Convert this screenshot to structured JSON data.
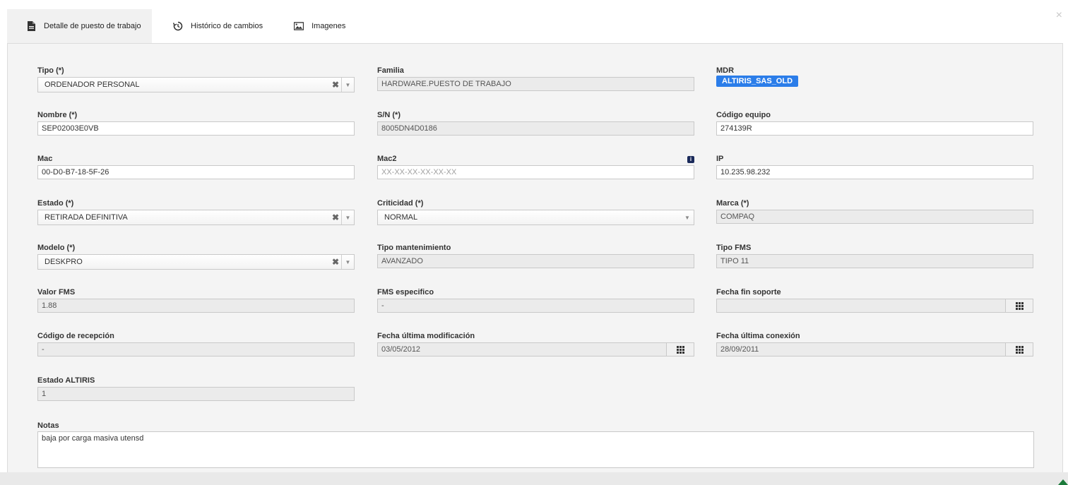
{
  "tabs": [
    {
      "label": "Detalle de puesto de trabajo",
      "icon": "document-icon",
      "active": true
    },
    {
      "label": "Histórico de cambios",
      "icon": "history-icon",
      "active": false
    },
    {
      "label": "Imagenes",
      "icon": "image-icon",
      "active": false
    }
  ],
  "close_label": "×",
  "fields": {
    "tipo": {
      "label": "Tipo (*)",
      "value": "ORDENADOR PERSONAL"
    },
    "familia": {
      "label": "Familia",
      "value": "HARDWARE.PUESTO DE TRABAJO"
    },
    "mdr": {
      "label": "MDR",
      "value": "ALTIRIS_SAS_OLD"
    },
    "nombre": {
      "label": "Nombre (*)",
      "value": "SEP02003E0VB"
    },
    "sn": {
      "label": "S/N (*)",
      "value": "8005DN4D0186"
    },
    "codigo_equipo": {
      "label": "Código equipo",
      "value": "274139R"
    },
    "mac": {
      "label": "Mac",
      "value": "00-D0-B7-18-5F-26"
    },
    "mac2": {
      "label": "Mac2",
      "placeholder": "XX-XX-XX-XX-XX-XX",
      "info_icon": "i"
    },
    "ip": {
      "label": "IP",
      "value": "10.235.98.232"
    },
    "estado": {
      "label": "Estado (*)",
      "value": "RETIRADA DEFINITIVA"
    },
    "criticidad": {
      "label": "Criticidad (*)",
      "value": "NORMAL"
    },
    "marca": {
      "label": "Marca (*)",
      "value": "COMPAQ"
    },
    "modelo": {
      "label": "Modelo (*)",
      "value": "DESKPRO"
    },
    "tipo_mantenimiento": {
      "label": "Tipo mantenimiento",
      "value": "AVANZADO"
    },
    "tipo_fms": {
      "label": "Tipo FMS",
      "value": "TIPO 11"
    },
    "valor_fms": {
      "label": "Valor FMS",
      "value": "1.88"
    },
    "fms_especifico": {
      "label": "FMS especifico",
      "value": "-"
    },
    "fecha_fin_soporte": {
      "label": "Fecha fin soporte",
      "value": ""
    },
    "codigo_recepcion": {
      "label": "Código de recepción",
      "value": "-"
    },
    "fecha_ultima_modificacion": {
      "label": "Fecha última modificación",
      "value": "03/05/2012"
    },
    "fecha_ultima_conexion": {
      "label": "Fecha última conexión",
      "value": "28/09/2011"
    },
    "estado_altiris": {
      "label": "Estado ALTIRIS",
      "value": "1"
    },
    "notas": {
      "label": "Notas",
      "value": "baja por carga masiva utensd"
    }
  },
  "glyphs": {
    "clear": "✖",
    "arrow": "▼"
  },
  "colors": {
    "badge": "#2b7de9",
    "panel": "#f4f4f4",
    "readonly": "#ebebeb",
    "corner_marker": "#1b7a3a"
  }
}
